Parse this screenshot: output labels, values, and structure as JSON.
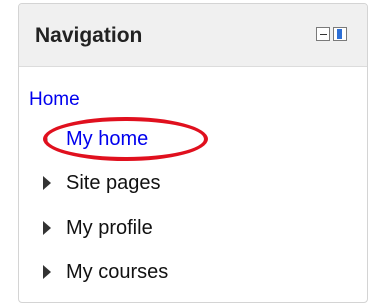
{
  "block": {
    "title": "Navigation",
    "controls": {
      "hide_icon": "minus-box-icon",
      "dock_icon": "dock-icon"
    }
  },
  "nav": {
    "home_label": "Home",
    "items": [
      {
        "label": "My home",
        "type": "link",
        "icon": "bullet-icon",
        "highlighted": true
      },
      {
        "label": "Site pages",
        "type": "branch",
        "icon": "triangle-right-icon"
      },
      {
        "label": "My profile",
        "type": "branch",
        "icon": "triangle-right-icon"
      },
      {
        "label": "My courses",
        "type": "branch",
        "icon": "triangle-right-icon"
      }
    ]
  },
  "colors": {
    "link": "#0000ee",
    "highlight_ring": "#e0101e",
    "header_bg": "#f0f0f0",
    "dock_accent": "#2d6fd6"
  }
}
